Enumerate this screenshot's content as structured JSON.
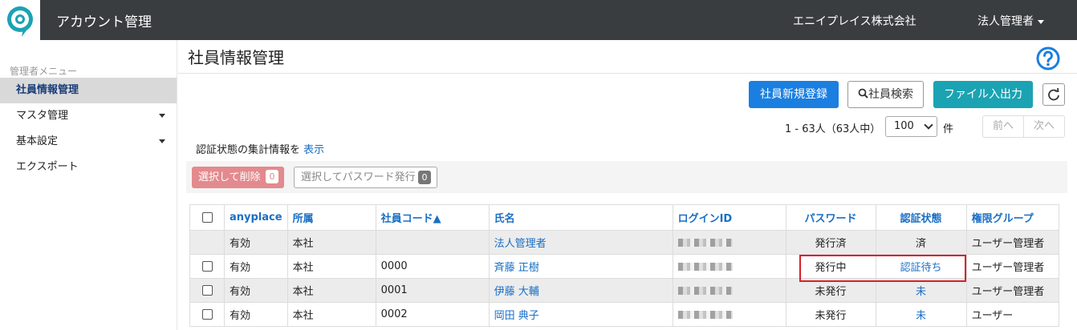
{
  "header": {
    "app_title": "アカウント管理",
    "company": "エニイプレイス株式会社",
    "user_menu": "法人管理者",
    "brand_color": "#1ba3b3"
  },
  "sidebar": {
    "heading": "管理者メニュー",
    "items": [
      {
        "label": "社員情報管理",
        "active": true
      },
      {
        "label": "マスタ管理",
        "has_submenu": true
      },
      {
        "label": "基本設定",
        "has_submenu": true
      },
      {
        "label": "エクスポート"
      }
    ]
  },
  "main": {
    "title": "社員情報管理",
    "help_icon": "question-circle-icon",
    "toolbar": {
      "new_label": "社員新規登録",
      "search_label": "社員検索",
      "file_label": "ファイル入出力",
      "refresh_icon": "refresh-icon"
    },
    "pagination": {
      "range_text": "1 - 63人（63人中）",
      "per_page": "100",
      "per_page_unit": "件",
      "prev_label": "前へ",
      "next_label": "次へ"
    },
    "auth_info": {
      "text": "認証状態の集計情報を",
      "link": "表示"
    },
    "actions": {
      "delete_label": "選択して削除",
      "delete_count": "0",
      "password_label": "選択してパスワード発行",
      "password_count": "0"
    },
    "table": {
      "headers": [
        "anyplace",
        "所属",
        "社員コード▲",
        "氏名",
        "ログインID",
        "パスワード",
        "認証状態",
        "権限グループ"
      ],
      "rows": [
        {
          "anyplace": "有効",
          "dept": "本社",
          "code": "",
          "name": "法人管理者",
          "password": "発行済",
          "auth": "済",
          "group": "ユーザー管理者",
          "checkbox": false
        },
        {
          "anyplace": "有効",
          "dept": "本社",
          "code": "0000",
          "name": "斉藤 正樹",
          "password": "発行中",
          "auth": "認証待ち",
          "group": "ユーザー管理者",
          "checkbox": true
        },
        {
          "anyplace": "有効",
          "dept": "本社",
          "code": "0001",
          "name": "伊藤 大輔",
          "password": "未発行",
          "auth": "未",
          "group": "ユーザー管理者",
          "checkbox": true
        },
        {
          "anyplace": "有効",
          "dept": "本社",
          "code": "0002",
          "name": "岡田 典子",
          "password": "未発行",
          "auth": "未",
          "group": "ユーザー",
          "checkbox": true
        }
      ]
    }
  }
}
